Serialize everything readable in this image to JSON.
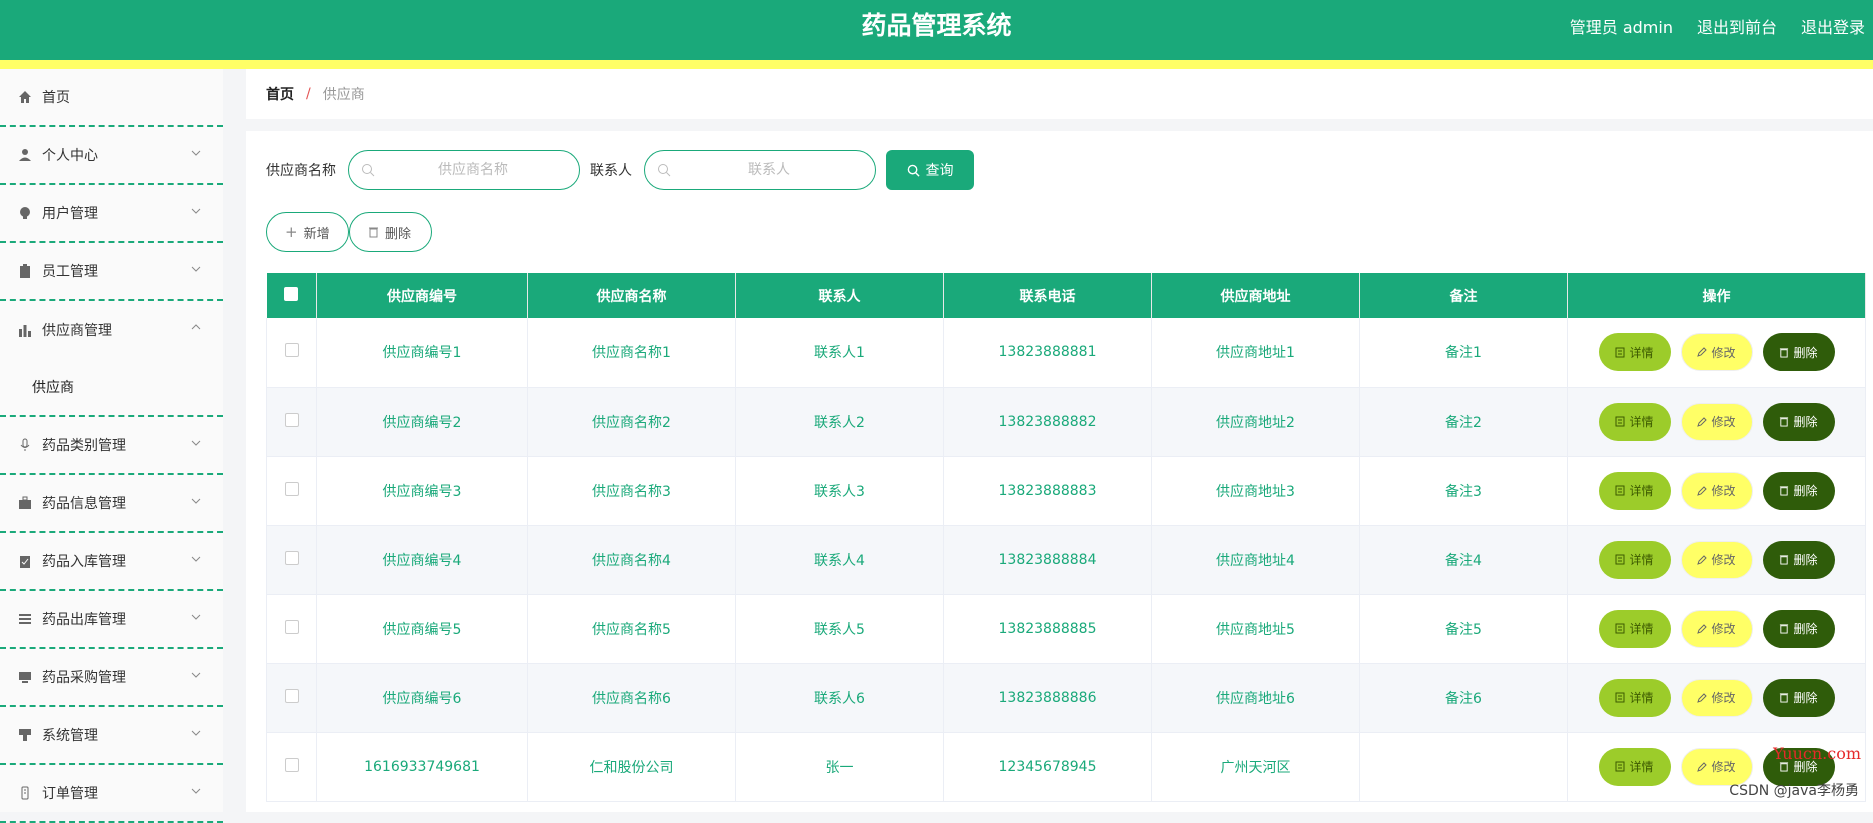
{
  "header": {
    "title": "药品管理系统",
    "user": "管理员 admin",
    "to_front": "退出到前台",
    "logout": "退出登录"
  },
  "sidebar": {
    "items": [
      {
        "label": "首页",
        "icon": "home-icon"
      },
      {
        "label": "个人中心",
        "icon": "user-icon"
      },
      {
        "label": "用户管理",
        "icon": "bulb-icon"
      },
      {
        "label": "员工管理",
        "icon": "clipboard-icon"
      },
      {
        "label": "供应商管理",
        "icon": "bar-chart-icon"
      },
      {
        "label": "药品类别管理",
        "icon": "mic-icon"
      },
      {
        "label": "药品信息管理",
        "icon": "briefcase-icon"
      },
      {
        "label": "药品入库管理",
        "icon": "check-clipboard-icon"
      },
      {
        "label": "药品出库管理",
        "icon": "list-icon"
      },
      {
        "label": "药品采购管理",
        "icon": "monitor-icon"
      },
      {
        "label": "系统管理",
        "icon": "brush-icon"
      },
      {
        "label": "订单管理",
        "icon": "doc-icon"
      }
    ],
    "submenu_label": "供应商"
  },
  "breadcrumb": {
    "home": "首页",
    "sep": "/",
    "current": "供应商"
  },
  "search": {
    "name_label": "供应商名称",
    "name_placeholder": "供应商名称",
    "contact_label": "联系人",
    "contact_placeholder": "联系人",
    "query_label": "查询"
  },
  "actions": {
    "add_label": "新增",
    "delete_label": "删除"
  },
  "table": {
    "headers": [
      "供应商编号",
      "供应商名称",
      "联系人",
      "联系电话",
      "供应商地址",
      "备注",
      "操作"
    ],
    "rows": [
      [
        "供应商编号1",
        "供应商名称1",
        "联系人1",
        "13823888881",
        "供应商地址1",
        "备注1"
      ],
      [
        "供应商编号2",
        "供应商名称2",
        "联系人2",
        "13823888882",
        "供应商地址2",
        "备注2"
      ],
      [
        "供应商编号3",
        "供应商名称3",
        "联系人3",
        "13823888883",
        "供应商地址3",
        "备注3"
      ],
      [
        "供应商编号4",
        "供应商名称4",
        "联系人4",
        "13823888884",
        "供应商地址4",
        "备注4"
      ],
      [
        "供应商编号5",
        "供应商名称5",
        "联系人5",
        "13823888885",
        "供应商地址5",
        "备注5"
      ],
      [
        "供应商编号6",
        "供应商名称6",
        "联系人6",
        "13823888886",
        "供应商地址6",
        "备注6"
      ],
      [
        "1616933749681",
        "仁和股份公司",
        "张一",
        "12345678945",
        "广州天河区",
        ""
      ]
    ],
    "op_detail": "详情",
    "op_edit": "修改",
    "op_delete": "删除"
  },
  "watermark": {
    "csdn": "CSDN @java李杨勇",
    "site": "Yuucn.com"
  },
  "colors": {
    "primary": "#1aa97a",
    "stripe": "#ffff66",
    "detail": "#9ccc2a",
    "edit": "#ffff66",
    "delete": "#2f5c0a"
  }
}
